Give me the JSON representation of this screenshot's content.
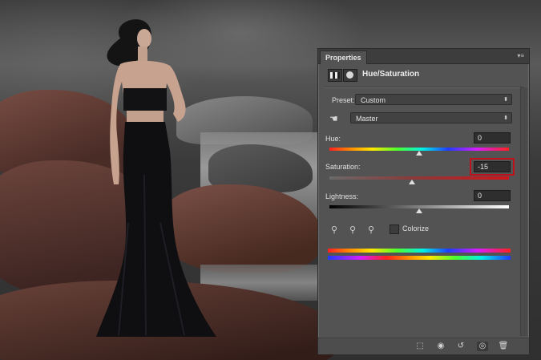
{
  "panel": {
    "tab_label": "Properties",
    "menu_glyph": "▾≡",
    "title": "Hue/Saturation",
    "preset": {
      "label": "Preset:",
      "value": "Custom"
    },
    "channel": {
      "value": "Master"
    },
    "hue": {
      "label": "Hue:",
      "value": "0",
      "level": 0.5
    },
    "saturation": {
      "label": "Saturation:",
      "value": "-15",
      "level": 0.46
    },
    "lightness": {
      "label": "Lightness:",
      "value": "0",
      "level": 0.5
    },
    "colorize": {
      "label": "Colorize",
      "checked": false
    },
    "highlight_color": "#c0121d"
  }
}
